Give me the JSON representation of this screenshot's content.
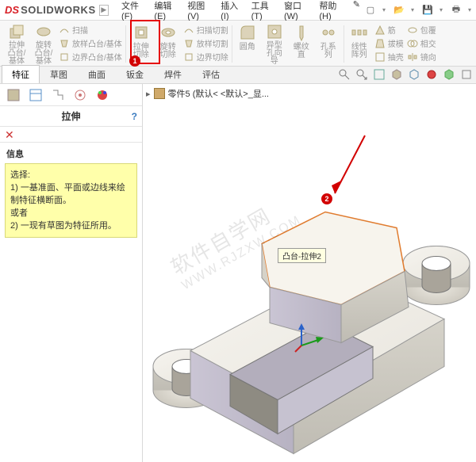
{
  "app": {
    "logo_ds": "DS",
    "logo_sw": "SOLIDWORKS"
  },
  "menu": {
    "file": "文件(F)",
    "edit": "编辑(E)",
    "view": "视图(V)",
    "insert": "插入(I)",
    "tools": "工具(T)",
    "window": "窗口(W)",
    "help": "帮助(H)",
    "search": "✎"
  },
  "ribbon": {
    "extrude": "拉伸凸台/基体",
    "revolve": "旋转凸台/基体",
    "sweep": "扫描",
    "loft": "放样凸台/基体",
    "boundary": "边界凸台/基体",
    "extrude_cut": "拉伸切除",
    "revolve_cut": "旋转切除",
    "sweep_cut": "扫描切割",
    "loft_cut": "放样切割",
    "boundary_cut": "边界切除",
    "fillet": "圆角",
    "linear_pattern": "线性阵列",
    "rib": "筋",
    "draft": "拔模",
    "shell": "抽壳",
    "wrap": "包覆",
    "intersect": "相交",
    "mirror": "镜向",
    "hole_wizard": "异型孔向导",
    "hole_series": "孔系列",
    "screw_straight": "螺纹直"
  },
  "tabs": {
    "feature": "特征",
    "sketch": "草图",
    "surface": "曲面",
    "sheetmetal": "钣金",
    "weldment": "焊件",
    "evaluate": "评估"
  },
  "panel": {
    "title": "拉伸",
    "info_label": "信息",
    "info1": "选择:",
    "info2": "1) 一基准面、平面或边线来绘制特征横断面。",
    "info3": "或者",
    "info4": "2) 一现有草图为特征所用。"
  },
  "viewport": {
    "path": "零件5  (默认< <默认>_显...",
    "tooltip": "凸台-拉伸2"
  },
  "annotations": {
    "marker1": "1",
    "marker2": "2"
  },
  "watermark": {
    "line1": "软件自学网",
    "line2": "WWW.RJZXW.COM"
  }
}
